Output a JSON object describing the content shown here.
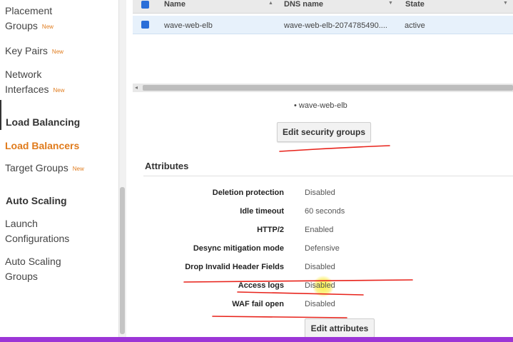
{
  "sidebar": {
    "items": [
      {
        "label_line1": "Placement",
        "label_line2": "Groups",
        "badge": "New"
      },
      {
        "label": "Key Pairs",
        "badge": "New"
      },
      {
        "label_line1": "Network",
        "label_line2": "Interfaces",
        "badge": "New"
      }
    ],
    "load_balancing": {
      "heading": "Load Balancing",
      "items": [
        {
          "label": "Load Balancers"
        },
        {
          "label": "Target Groups",
          "badge": "New"
        }
      ]
    },
    "auto_scaling": {
      "heading": "Auto Scaling",
      "items": [
        {
          "label_line1": "Launch",
          "label_line2": "Configurations"
        },
        {
          "label_line1": "Auto Scaling",
          "label_line2": "Groups"
        }
      ]
    }
  },
  "table": {
    "columns": [
      "Name",
      "DNS name",
      "State"
    ],
    "rows": [
      {
        "name": "wave-web-elb",
        "dns": "wave-web-elb-2074785490....",
        "state": "active"
      }
    ]
  },
  "security_groups": {
    "item": "• wave-web-elb",
    "edit_button": "Edit security groups"
  },
  "attributes": {
    "title": "Attributes",
    "rows": [
      {
        "label": "Deletion protection",
        "value": "Disabled"
      },
      {
        "label": "Idle timeout",
        "value": "60 seconds"
      },
      {
        "label": "HTTP/2",
        "value": "Enabled"
      },
      {
        "label": "Desync mitigation mode",
        "value": "Defensive"
      },
      {
        "label": "Drop Invalid Header Fields",
        "value": "Disabled"
      },
      {
        "label": "Access logs",
        "value": "Disabled"
      },
      {
        "label": "WAF fail open",
        "value": "Disabled"
      }
    ],
    "edit_button": "Edit attributes"
  },
  "colors": {
    "accent_orange": "#e07b1c",
    "selected_checkbox": "#2a6ed8",
    "annotation_red": "#e8231b",
    "bottom_bar_purple": "#9c35d6",
    "cursor_highlight": "#f5e83c"
  }
}
